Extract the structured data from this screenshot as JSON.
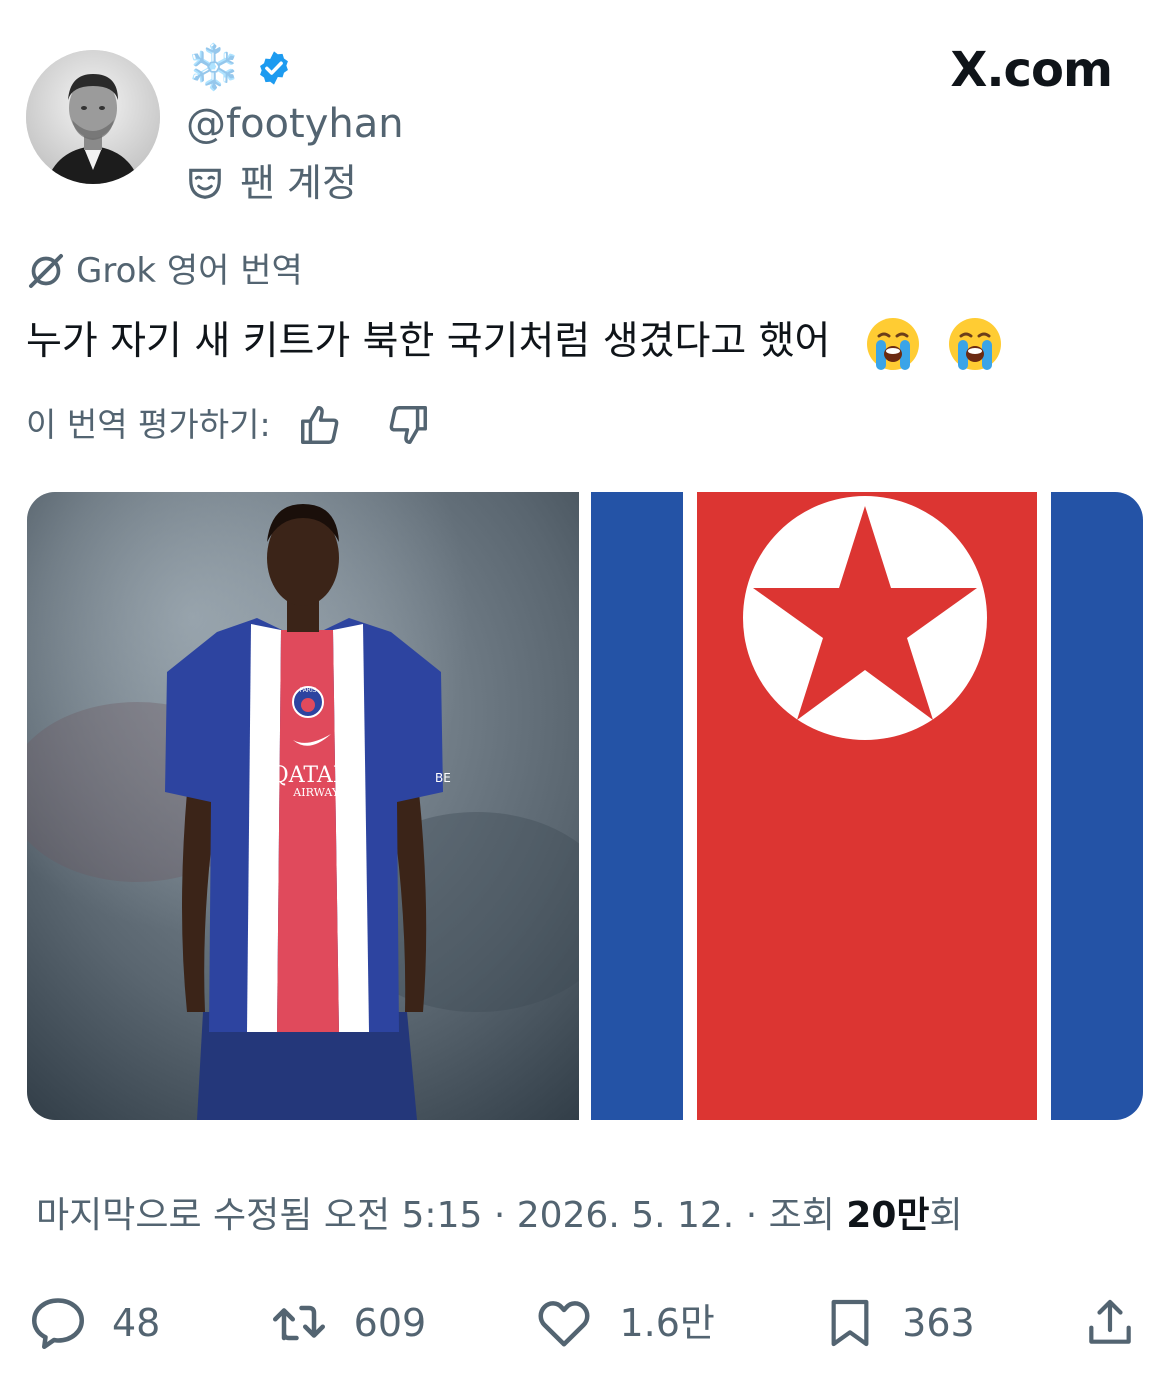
{
  "watermark": "X.com",
  "author": {
    "display_name": "❄️",
    "handle": "@footyhan",
    "account_type_label": "팬 계정"
  },
  "translation": {
    "source_label": "Grok 영어 번역",
    "text": "누가 자기 새 키트가 북한 국기처럼 생겼다고 했어",
    "emojis": [
      "😭",
      "😭"
    ],
    "rate_label": "이 번역 평가하기:"
  },
  "media": {
    "left_image": {
      "crest_text": "PARIS",
      "sponsor_line1": "QATAR",
      "sponsor_line2": "AIRWAYS",
      "sleeve_text": "BE"
    },
    "right_image": "north-korea-flag"
  },
  "meta": {
    "edited_prefix": "마지막으로 수정됨 오전 5:15 · 2026. 5. 12.  · 조회 ",
    "views": "20만",
    "views_suffix": "회"
  },
  "actions": {
    "replies": "48",
    "reposts": "609",
    "likes": "1.6만",
    "bookmarks": "363"
  },
  "colors": {
    "text_secondary": "#536471",
    "verified": "#1d9bf0",
    "flag_blue": "#2453a6",
    "flag_red": "#dc3532"
  }
}
